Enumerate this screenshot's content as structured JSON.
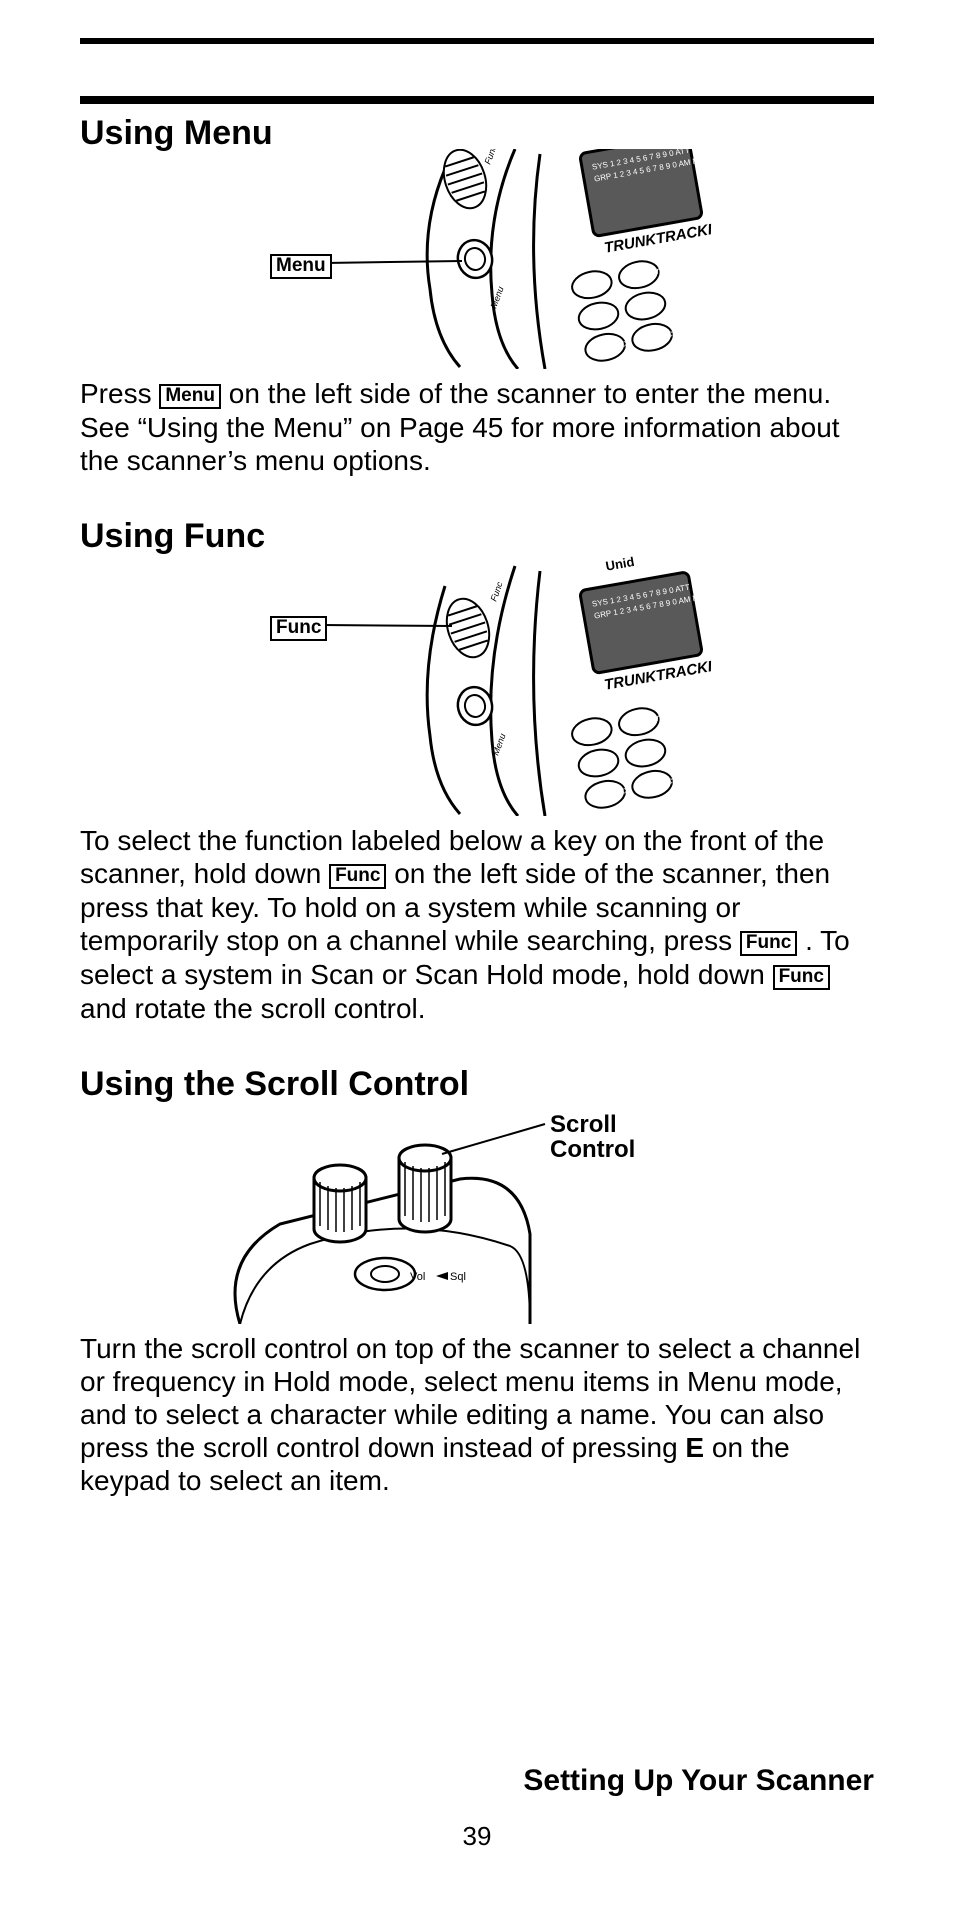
{
  "heading_menu": "Using Menu",
  "heading_func": "Using Func",
  "heading_scroll": "Using the Scroll Control",
  "key_menu": "Menu",
  "key_func": "Func",
  "fig1_label": "Menu",
  "fig2_label": "Func",
  "fig3_label": "Scroll Control",
  "p1_a": "Press ",
  "p1_b": " on the left side of the scanner to enter the menu. See “Using the Menu” on Page 45 for more information about the scanner’s menu options.",
  "p2_a": "To select the function labeled below a key on the front of the scanner, hold down ",
  "p2_b": " on the left side of the scanner, then press that key. To hold on a system while scanning or temporarily stop on a channel while searching, press ",
  "p2_c": " . To select a system in Scan or Scan Hold mode, hold down ",
  "p2_d": " and rotate the scroll control.",
  "p3_a": "Turn the scroll control on top of the scanner to select a channel or frequency in Hold mode, select menu items in Menu mode, and to select a character while editing a name. You can also press the scroll control down instead of pressing ",
  "p3_e": "E",
  "p3_b": " on the keypad to select an item.",
  "footer": "Setting Up Your Scanner",
  "page_number": "39"
}
